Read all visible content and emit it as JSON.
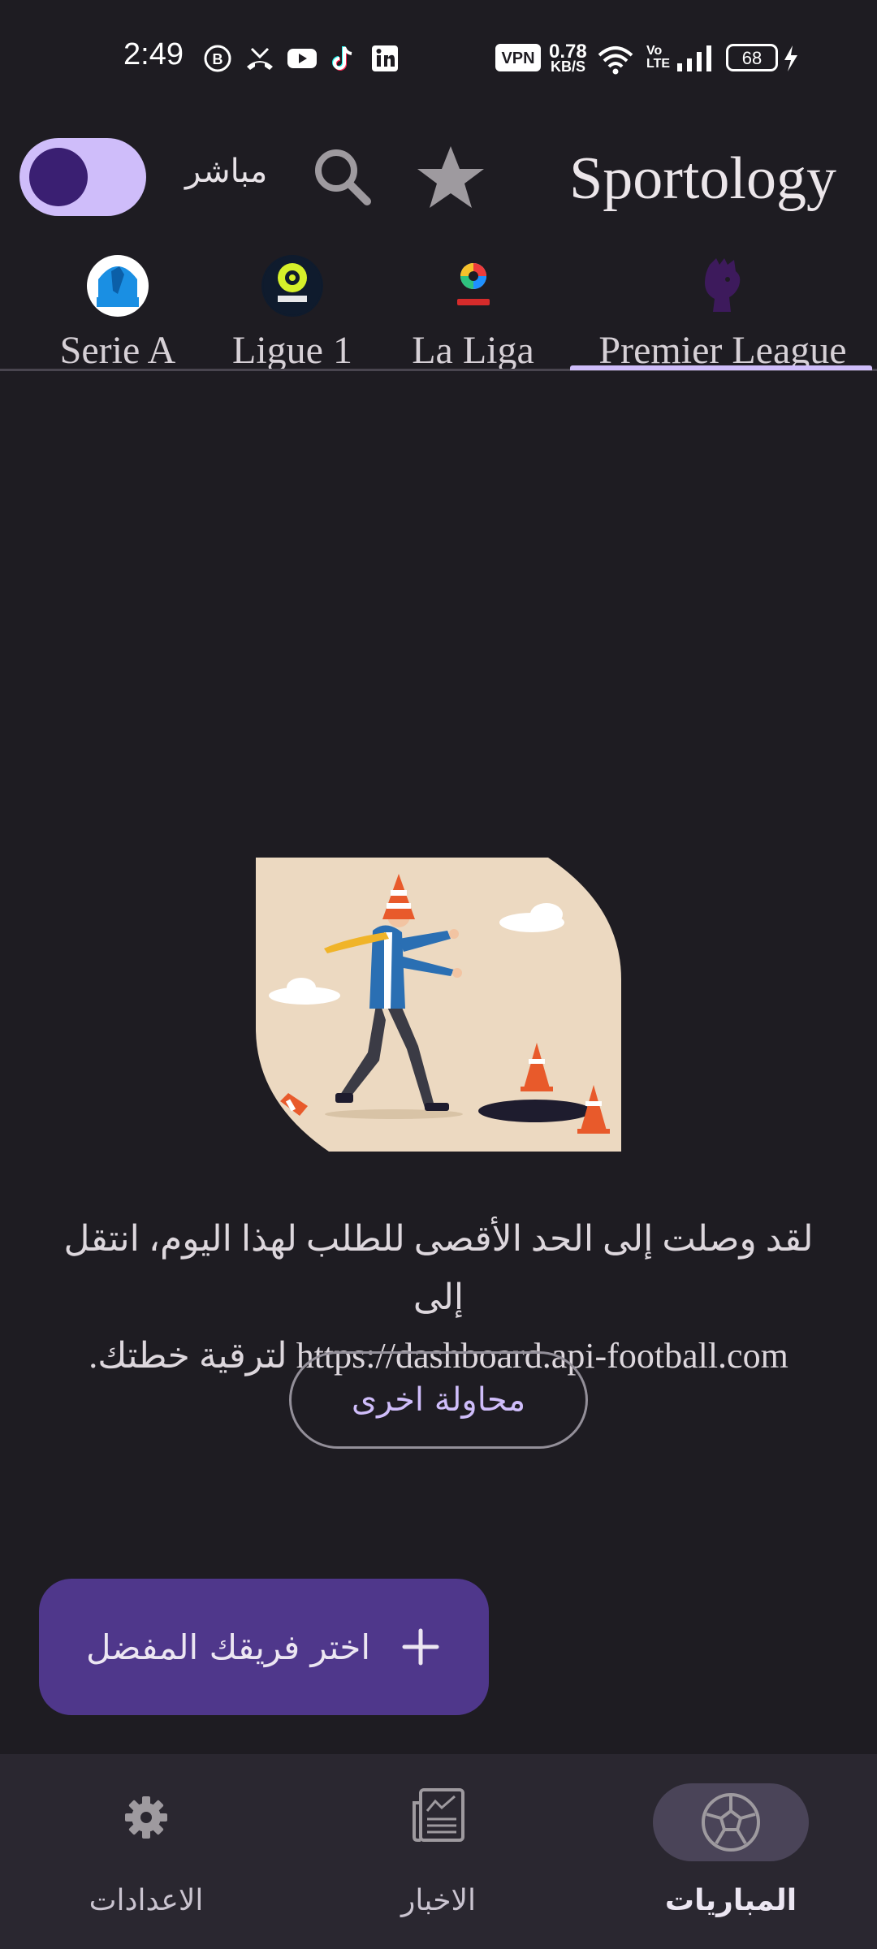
{
  "status_bar": {
    "time": "2:49",
    "vpn": "VPN",
    "speed_value": "0.78",
    "speed_unit": "KB/S",
    "volte_top": "Vo",
    "volte_bottom": "LTE",
    "battery": "68",
    "icons": [
      "b-circle-icon",
      "missed-call-icon",
      "youtube-icon",
      "tiktok-icon",
      "linkedin-icon",
      "wifi-icon",
      "signal-icon",
      "battery-icon",
      "charging-icon"
    ]
  },
  "app_bar": {
    "title": "Sportology",
    "live_label": "مباشر",
    "toggle_on": true
  },
  "tabs": [
    {
      "label": "Serie A",
      "logo": "serie-a-logo"
    },
    {
      "label": "Ligue 1",
      "logo": "ligue-1-logo"
    },
    {
      "label": "La Liga",
      "logo": "la-liga-logo"
    },
    {
      "label": "Premier League",
      "logo": "premier-league-logo",
      "selected": true
    }
  ],
  "error": {
    "message_line1": "لقد وصلت إلى الحد الأقصى للطلب لهذا اليوم، انتقل إلى",
    "message_line2": "https://dashboard.api-football.com لترقية خطتك.",
    "retry_label": "محاولة اخرى"
  },
  "fab": {
    "label": "اختر فريقك المفضل",
    "icon": "plus-icon"
  },
  "bottom_nav": [
    {
      "label": "الاعدادات",
      "icon": "gear-icon"
    },
    {
      "label": "الاخبار",
      "icon": "newspaper-icon"
    },
    {
      "label": "المباريات",
      "icon": "soccer-ball-icon",
      "selected": true
    }
  ],
  "colors": {
    "background": "#1e1c22",
    "accent": "#cfbdfa",
    "fab": "#4f378b",
    "nav_bar": "#2a2730"
  }
}
